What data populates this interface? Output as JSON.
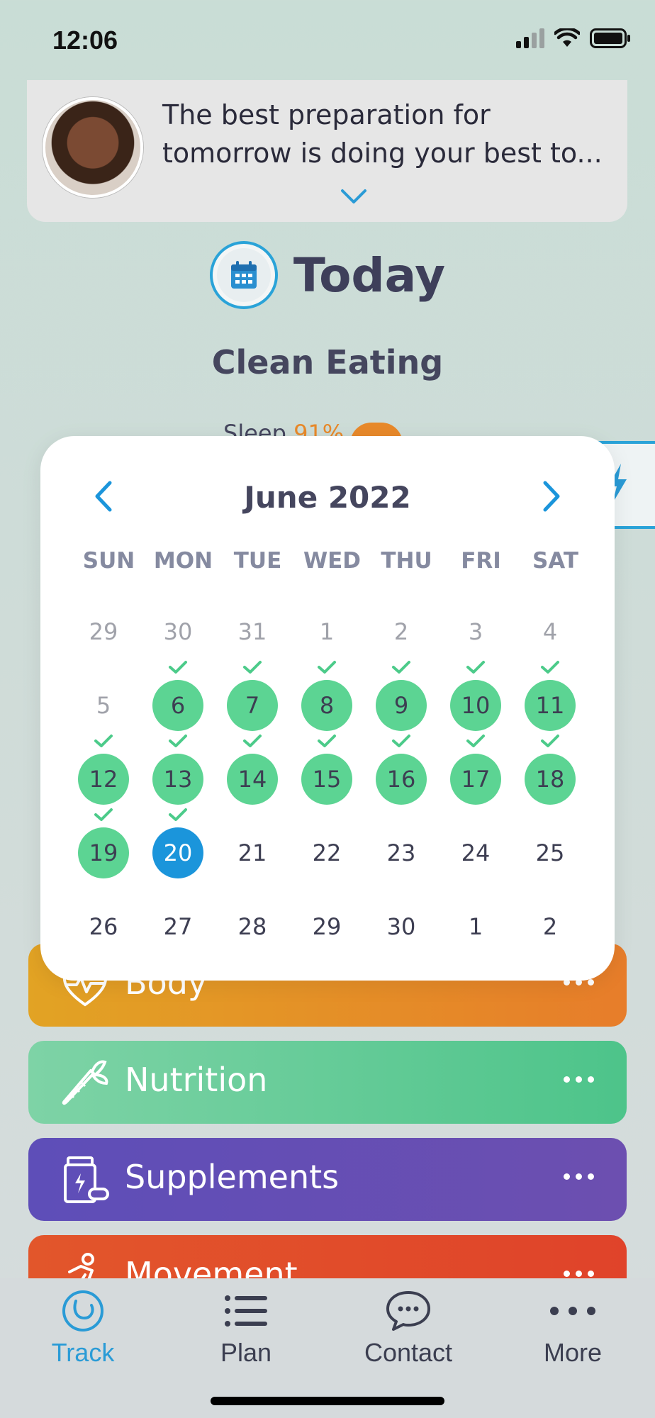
{
  "status_bar": {
    "time": "12:06"
  },
  "quote": {
    "text": "The best preparation for tomorrow is doing your best to..."
  },
  "header": {
    "title": "Today",
    "plan_name": "Clean Eating"
  },
  "sleep": {
    "label": "Sleep",
    "percent": "91%"
  },
  "calendar": {
    "month_title": "June 2022",
    "weekdays": [
      "SUN",
      "MON",
      "TUE",
      "WED",
      "THU",
      "FRI",
      "SAT"
    ],
    "weeks": [
      [
        "29",
        "30",
        "31",
        "1",
        "2",
        "3",
        "4"
      ],
      [
        "5",
        "6",
        "7",
        "8",
        "9",
        "10",
        "11"
      ],
      [
        "12",
        "13",
        "14",
        "15",
        "16",
        "17",
        "18"
      ],
      [
        "19",
        "20",
        "21",
        "22",
        "23",
        "24",
        "25"
      ],
      [
        "26",
        "27",
        "28",
        "29",
        "30",
        "1",
        "2"
      ]
    ],
    "completed_days": [
      "6",
      "7",
      "8",
      "9",
      "10",
      "11",
      "12",
      "13",
      "14",
      "15",
      "16",
      "17",
      "18",
      "19"
    ],
    "selected_day": "20",
    "colors": {
      "completed": "#5cd493",
      "selected": "#1b95db",
      "check": "#4ccb8a"
    }
  },
  "categories": [
    {
      "label": "Body",
      "icon": "heart-pulse-icon",
      "color": "#e58f27"
    },
    {
      "label": "Nutrition",
      "icon": "carrot-icon",
      "color": "#6ccc9a"
    },
    {
      "label": "Supplements",
      "icon": "supplement-bottle-icon",
      "color": "#6550b5"
    },
    {
      "label": "Movement",
      "icon": "running-person-icon",
      "color": "#e04d2a"
    }
  ],
  "tab_bar": {
    "tabs": [
      {
        "label": "Track",
        "icon": "track-spiral-icon",
        "active": true
      },
      {
        "label": "Plan",
        "icon": "list-icon",
        "active": false
      },
      {
        "label": "Contact",
        "icon": "chat-bubble-icon",
        "active": false
      },
      {
        "label": "More",
        "icon": "more-dots-icon",
        "active": false
      }
    ],
    "accent": "#2a9bd6"
  }
}
